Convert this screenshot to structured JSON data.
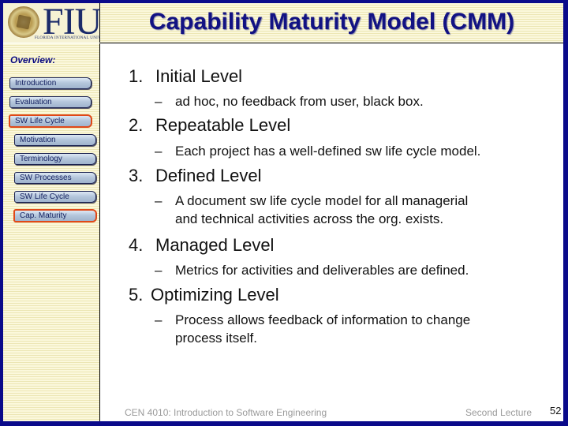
{
  "header": {
    "logo_text": "FIU",
    "logo_subtext": "FLORIDA INTERNATIONAL UNIVERSITY",
    "title": "Capability Maturity Model (CMM)"
  },
  "sidebar": {
    "overview_label": "Overview:",
    "items": [
      {
        "label": "Introduction",
        "active": false,
        "indent": 0
      },
      {
        "label": "Evaluation",
        "active": false,
        "indent": 0
      },
      {
        "label": "SW Life Cycle",
        "active": true,
        "indent": 0
      },
      {
        "label": "Motivation",
        "active": false,
        "indent": 1
      },
      {
        "label": "Terminology",
        "active": false,
        "indent": 1
      },
      {
        "label": "SW Processes",
        "active": false,
        "indent": 1
      },
      {
        "label": "SW Life Cycle",
        "active": false,
        "indent": 1
      },
      {
        "label": "Cap. Maturity",
        "active": true,
        "indent": 1
      }
    ]
  },
  "content": {
    "levels": [
      {
        "number": "1.",
        "title": "Initial Level",
        "details": [
          "ad hoc, no feedback from user, black box."
        ]
      },
      {
        "number": "2.",
        "title": "Repeatable Level",
        "details": [
          "Each project has a well-defined sw life cycle model."
        ]
      },
      {
        "number": "3.",
        "title": "Defined Level",
        "details": [
          "A document sw life cycle model for all managerial",
          "and technical activities across the org. exists."
        ]
      },
      {
        "number": "4.",
        "title": "Managed Level",
        "details": [
          "Metrics for activities and deliverables are defined."
        ]
      },
      {
        "number": "5.",
        "title": "Optimizing Level",
        "details": [
          "Process allows feedback of information to change",
          "process itself."
        ]
      }
    ],
    "dash": "–"
  },
  "footer": {
    "course": "CEN 4010: Introduction to Software Engineering",
    "lecture": "Second Lecture",
    "page_number": "52"
  },
  "colors": {
    "border": "#0a0a8a",
    "title": "#121283",
    "active_outline": "#e04818",
    "stripe_bg": "#fbf8dc"
  }
}
